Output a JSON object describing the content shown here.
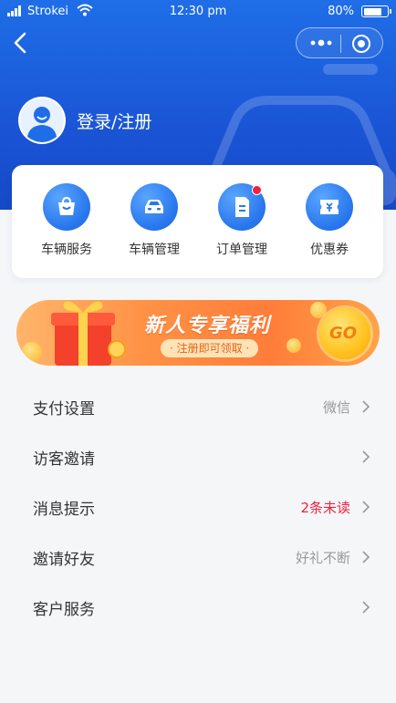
{
  "status_bar": {
    "carrier": "Strokei",
    "time": "12:30 pm",
    "battery_text": "80%",
    "battery_level": 0.8
  },
  "nav": {
    "back_icon": "back-arrow-icon",
    "more_icon": "more-dots-icon",
    "close_icon": "target-close-icon"
  },
  "profile": {
    "login_label": "登录/注册",
    "avatar_icon": "user-avatar-icon"
  },
  "quick_actions": [
    {
      "label": "车辆服务",
      "icon": "shopping-bag-icon",
      "has_dot": false
    },
    {
      "label": "车辆管理",
      "icon": "car-icon",
      "has_dot": false
    },
    {
      "label": "订单管理",
      "icon": "document-icon",
      "has_dot": true
    },
    {
      "label": "优惠券",
      "icon": "coupon-icon",
      "has_dot": false
    }
  ],
  "banner": {
    "title": "新人专享福利",
    "subtitle": "· 注册即可领取 ·",
    "go_label": "GO"
  },
  "menu": [
    {
      "title": "支付设置",
      "value": "微信"
    },
    {
      "title": "访客邀请",
      "value": ""
    },
    {
      "title": "消息提示",
      "value": "2条未读",
      "value_color": "#f0213c"
    },
    {
      "title": "邀请好友",
      "value": "好礼不断"
    },
    {
      "title": "客户服务",
      "value": ""
    }
  ],
  "colors": {
    "primary": "#1f6ee8",
    "alert": "#f0213c",
    "banner": "#ff9245"
  }
}
